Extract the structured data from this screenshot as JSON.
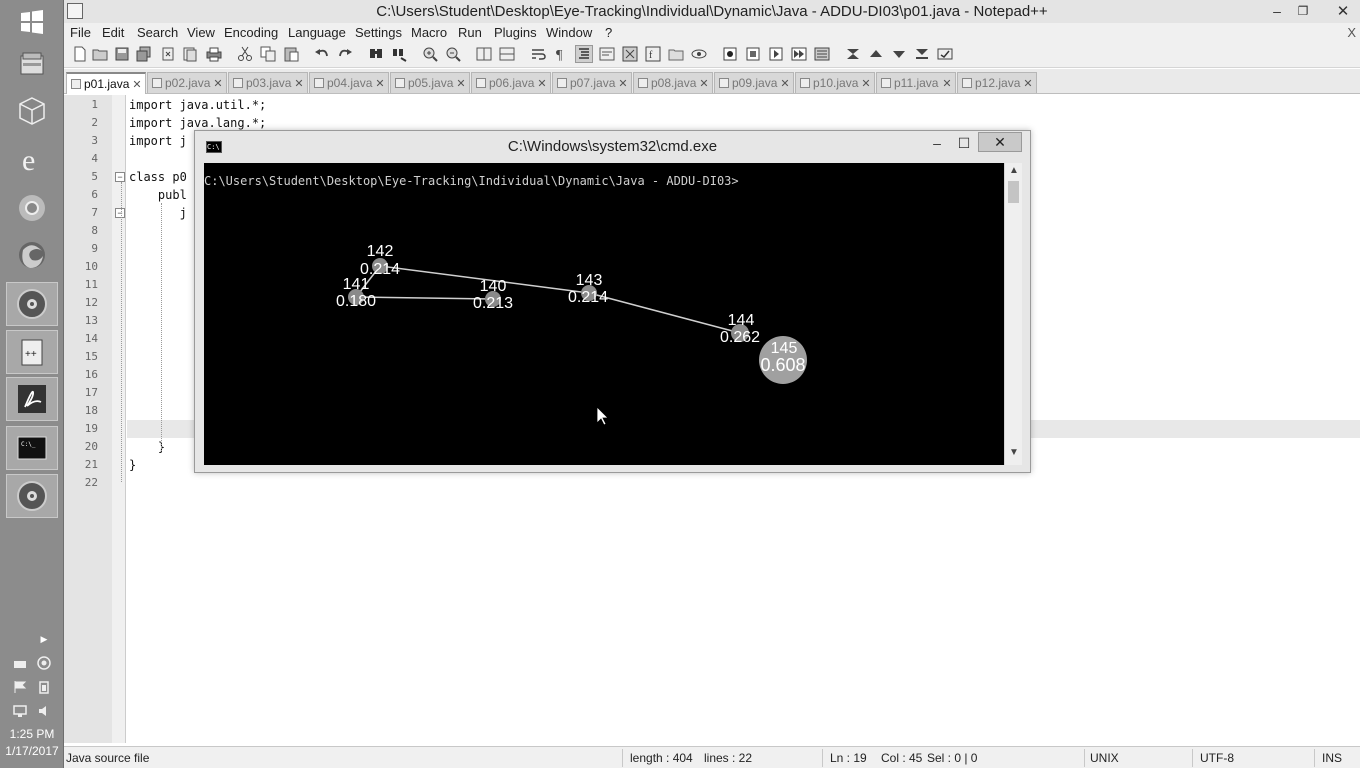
{
  "taskbar": {
    "items": [
      {
        "name": "start",
        "icon": "windows-logo-icon"
      },
      {
        "name": "file-explorer",
        "icon": "file-cabinet-icon"
      },
      {
        "name": "virtualbox",
        "icon": "cube-icon"
      },
      {
        "name": "internet-explorer",
        "icon": "ie-icon"
      },
      {
        "name": "chrome",
        "icon": "chrome-icon"
      },
      {
        "name": "firefox",
        "icon": "firefox-icon"
      },
      {
        "name": "media-player",
        "icon": "disc-icon"
      },
      {
        "name": "notepad-plus-plus",
        "icon": "notepad-icon"
      },
      {
        "name": "acrobat",
        "icon": "pdf-icon"
      },
      {
        "name": "command-prompt",
        "icon": "cmd-icon"
      },
      {
        "name": "media-player-2",
        "icon": "disc-icon"
      }
    ],
    "clock": {
      "time": "1:25 PM",
      "date": "1/17/2017"
    }
  },
  "window": {
    "title": "C:\\Users\\Student\\Desktop\\Eye-Tracking\\Individual\\Dynamic\\Java - ADDU-DI03\\p01.java - Notepad++",
    "minimize": "–",
    "maximize": "❐",
    "close": "✕"
  },
  "menu": {
    "items": [
      "File",
      "Edit",
      "Search",
      "View",
      "Encoding",
      "Language",
      "Settings",
      "Macro",
      "Run",
      "Plugins",
      "Window",
      "?"
    ],
    "close": "X"
  },
  "tabs": [
    {
      "label": "p01.java",
      "active": true
    },
    {
      "label": "p02.java"
    },
    {
      "label": "p03.java"
    },
    {
      "label": "p04.java"
    },
    {
      "label": "p05.java"
    },
    {
      "label": "p06.java"
    },
    {
      "label": "p07.java"
    },
    {
      "label": "p08.java"
    },
    {
      "label": "p09.java"
    },
    {
      "label": "p10.java"
    },
    {
      "label": "p11.java"
    },
    {
      "label": "p12.java"
    }
  ],
  "tab_close": "✕",
  "editor": {
    "line_numbers": [
      "1",
      "2",
      "3",
      "4",
      "5",
      "6",
      "7",
      "8",
      "9",
      "10",
      "11",
      "12",
      "13",
      "14",
      "15",
      "16",
      "17",
      "18",
      "19",
      "20",
      "21",
      "22"
    ],
    "code": {
      "l1": "import java.util.*;",
      "l2": "import java.lang.*;",
      "l3": "import j",
      "l5": "class p0",
      "l6": "    publ",
      "l7": "       j",
      "l20": "    }",
      "l21": "}"
    },
    "fold_minus": "−"
  },
  "statusbar": {
    "file_type": "Java source file",
    "length": "length : 404",
    "lines": "lines : 22",
    "ln": "Ln : 19",
    "col": "Col : 45",
    "sel": "Sel : 0 | 0",
    "eol": "UNIX",
    "encoding": "UTF-8",
    "mode": "INS"
  },
  "cmd": {
    "title": "C:\\Windows\\system32\\cmd.exe",
    "icon_text": "C:\\",
    "minimize": "–",
    "maximize": "☐",
    "close": "✕",
    "prompt": "C:\\Users\\Student\\Desktop\\Eye-Tracking\\Individual\\Dynamic\\Java - ADDU-DI03>",
    "scroll_up": "▲",
    "scroll_down": "▼"
  },
  "gaze": {
    "fixations": [
      {
        "id": "142",
        "duration": "0.214"
      },
      {
        "id": "141",
        "duration": "0.180"
      },
      {
        "id": "140",
        "duration": "0.213"
      },
      {
        "id": "143",
        "duration": "0.214"
      },
      {
        "id": "144",
        "duration": "0.262"
      },
      {
        "id": "145",
        "duration": "0.608"
      }
    ]
  }
}
